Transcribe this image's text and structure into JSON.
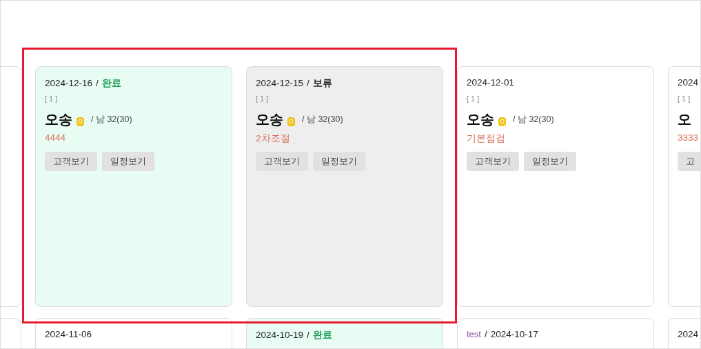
{
  "highlight": {
    "shown": true
  },
  "rows": [
    {
      "cards": [
        {
          "date": "2024-12-16",
          "sep": "/",
          "status": {
            "label": "완료",
            "kind": "done"
          },
          "count": "[ 1 ]",
          "name": "오송",
          "grade": "G",
          "info": "/ 남 32(30)",
          "memo": "4444",
          "buttons": [
            "고객보기",
            "일정보기"
          ]
        },
        {
          "date": "2024-12-15",
          "sep": "/",
          "status": {
            "label": "보류",
            "kind": "hold"
          },
          "count": "[ 1 ]",
          "name": "오송",
          "grade": "G",
          "info": "/ 남 32(30)",
          "memo": "2차조절",
          "buttons": [
            "고객보기",
            "일정보기"
          ]
        },
        {
          "date": "2024-12-01",
          "count": "[ 1 ]",
          "name": "오송",
          "grade": "G",
          "info": "/ 남 32(30)",
          "memo": "기본점검",
          "buttons": [
            "고객보기",
            "일정보기"
          ]
        },
        {
          "date": "2024",
          "count": "[ 1 ]",
          "name": "오",
          "memo": "3333",
          "buttons": [
            "고"
          ]
        }
      ]
    },
    {
      "cards": [
        {
          "date": "2024-11-06"
        },
        {
          "date": "2024-10-19",
          "sep": "/",
          "status": {
            "label": "완료",
            "kind": "done"
          }
        },
        {
          "tag": "test",
          "sep": "/",
          "date": "2024-10-17"
        },
        {
          "date": "2024"
        }
      ]
    }
  ]
}
